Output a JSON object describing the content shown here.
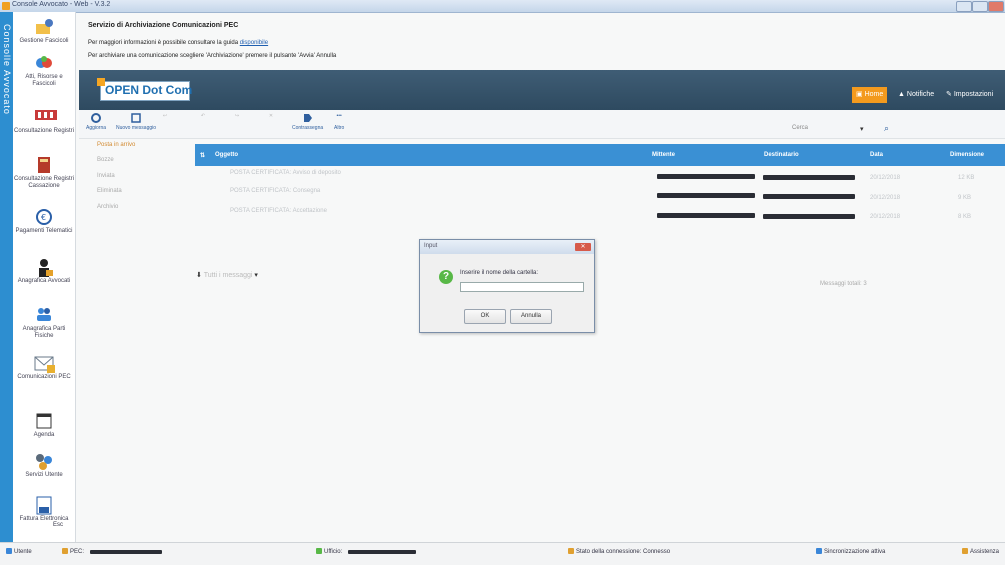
{
  "window": {
    "title": "Console Avvocato - Web - V.3.2"
  },
  "app": {
    "vertical_title": "Consolle Avvocato"
  },
  "sidebar": {
    "items": [
      {
        "label": "Gestione Fascicoli",
        "icon": "folder-gear-icon"
      },
      {
        "label": "Atti, Risorse e Fascicoli",
        "icon": "hands-icon"
      },
      {
        "label": "Consultazione Registri",
        "icon": "registry-icon"
      },
      {
        "label": "Consultazione Registri Cassazione",
        "icon": "book-icon"
      },
      {
        "label": "Pagamenti Telematici",
        "icon": "euro-icon"
      },
      {
        "label": "Anagrafica Avvocati",
        "icon": "lawyer-icon"
      },
      {
        "label": "Anagrafica Parti Fisiche",
        "icon": "people-icon"
      },
      {
        "label": "Comunicazioni PEC",
        "icon": "mail-lock-icon"
      },
      {
        "label": "Agenda",
        "icon": "calendar-icon"
      },
      {
        "label": "Servizi Utente",
        "icon": "gear-cluster-icon"
      },
      {
        "label": "Fattura Elettronica",
        "icon": "invoice-icon"
      }
    ],
    "footer": "Esc"
  },
  "header": {
    "title": "Servizio di Archiviazione Comunicazioni PEC",
    "line1": "Per maggiori informazioni è possibile consultare la guida ",
    "line1_link": "disponibile",
    "line2": "Per archiviare una comunicazione scegliere 'Archiviazione' premere il pulsante 'Avvia'   Annulla"
  },
  "banner": {
    "logo": "OPEN Dot Com",
    "buttons": [
      {
        "label": "Home"
      },
      {
        "label": "Notifiche"
      },
      {
        "label": "Impostazioni"
      }
    ]
  },
  "toolbar": {
    "items": [
      {
        "label": "Aggiorna",
        "icon": "refresh-icon"
      },
      {
        "label": "Nuovo messaggio",
        "icon": "edit-icon"
      },
      {
        "label": "",
        "icon": "reply-icon"
      },
      {
        "label": "",
        "icon": "reply-all-icon"
      },
      {
        "label": "",
        "icon": "forward-icon"
      },
      {
        "label": "",
        "icon": "delete-icon"
      },
      {
        "label": "Contrassegna",
        "icon": "tag-icon"
      },
      {
        "label": "Altro",
        "icon": "more-icon"
      }
    ],
    "search_placeholder": "Cerca"
  },
  "folders": [
    {
      "label": "Posta in arrivo",
      "active": true
    },
    {
      "label": "Bozze",
      "active": false
    },
    {
      "label": "Inviata",
      "active": false
    },
    {
      "label": "Eliminata",
      "active": false
    },
    {
      "label": "Archivio",
      "active": false
    }
  ],
  "grid": {
    "columns": [
      "Oggetto",
      "Mittente",
      "Destinatario",
      "Data",
      "Dimensione"
    ],
    "rows": [
      {
        "subject": "POSTA CERTIFICATA: Avviso di deposito",
        "date": "20/12/2018",
        "size": "12 KB"
      },
      {
        "subject": "POSTA CERTIFICATA: Consegna",
        "date": "20/12/2018",
        "size": "9 KB"
      },
      {
        "subject": "POSTA CERTIFICATA: Accettazione",
        "date": "20/12/2018",
        "size": "8 KB"
      }
    ],
    "footer_left": "Tutti i messaggi",
    "footer_right": "Messaggi totali: 3"
  },
  "dialog": {
    "title": "Input",
    "label": "Inserire il nome della cartella:",
    "value": "",
    "ok": "OK",
    "cancel": "Annulla"
  },
  "status": {
    "user_label": "Utente",
    "pec_label": "PEC:",
    "env_label": "Ufficio:",
    "connection": "Stato della connessione: Connesso",
    "right1": "Sincronizzazione attiva",
    "right2": "Assistenza"
  },
  "colors": {
    "accent": "#3a90d4",
    "banner": "#2e4a60",
    "home_button": "#f39a1e"
  }
}
